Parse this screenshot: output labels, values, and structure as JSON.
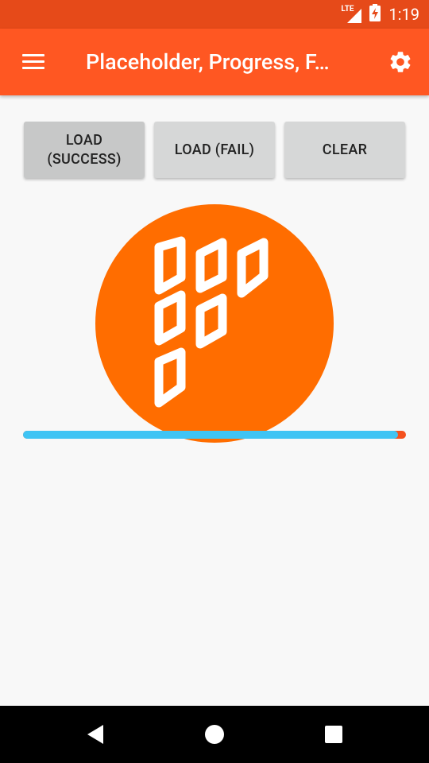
{
  "status_bar": {
    "network_label": "LTE",
    "time": "1:19"
  },
  "toolbar": {
    "title": "Placeholder, Progress, F…"
  },
  "buttons": {
    "load_success": "LOAD\n(SUCCESS)",
    "load_fail": "LOAD (FAIL)",
    "clear": "CLEAR"
  },
  "image": {
    "icon": "fresco-logo",
    "background_color": "#ff6d00"
  },
  "progress": {
    "value_fraction": 0.98,
    "fill_color": "#3fc4f4",
    "track_color": "#f4511e"
  },
  "colors": {
    "status_bar": "#e64a19",
    "toolbar": "#ff5722"
  },
  "icons": {
    "menu": "hamburger-menu-icon",
    "settings": "gear-icon",
    "back": "back-triangle-icon",
    "home": "home-circle-icon",
    "recents": "recents-square-icon"
  }
}
